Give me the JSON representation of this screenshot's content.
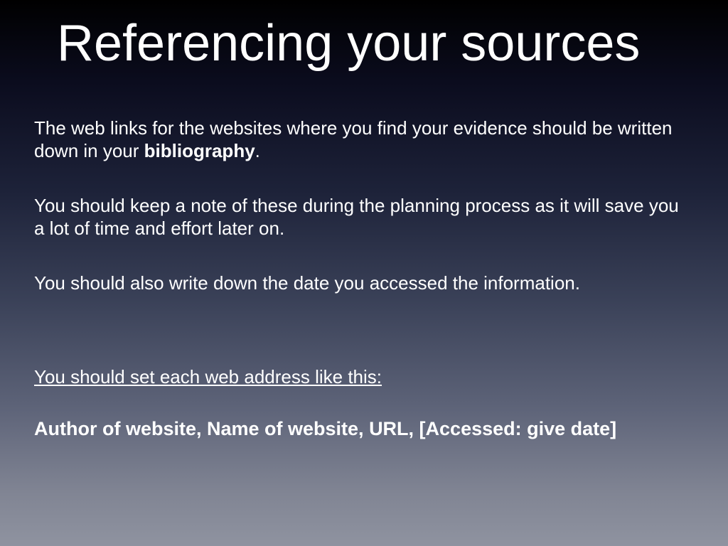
{
  "title": "Referencing your sources",
  "p1a": "The web links for the websites where you find your evidence should be written down in your ",
  "p1b": "bibliography",
  "p1c": ".",
  "p2": "You should keep a note of these during the planning process as it will save you a lot of time and effort later on.",
  "p3": "You should also write down the date you accessed the information.",
  "p4": "You should set each web address like this:",
  "p5": "Author of website, Name of website, URL, [Accessed: give date]"
}
